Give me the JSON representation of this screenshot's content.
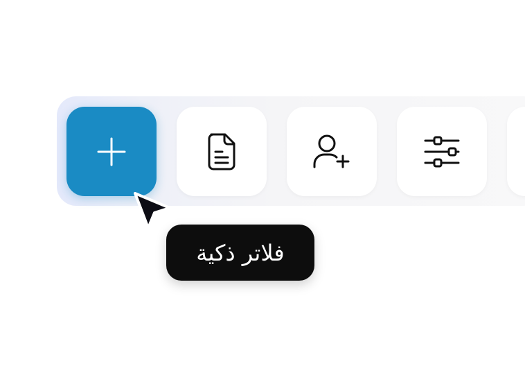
{
  "toolbar": {
    "buttons": [
      {
        "icon": "plus-icon",
        "accent": "#1a8bc4",
        "state": "active"
      },
      {
        "icon": "document-icon"
      },
      {
        "icon": "add-user-icon"
      },
      {
        "icon": "filter-sliders-icon"
      },
      {
        "icon": "partially-visible-button"
      }
    ]
  },
  "tooltip": {
    "text": "فلاتر ذكية"
  },
  "colors": {
    "accent": "#1a8bc4",
    "tooltip_bg": "#0d0d0d",
    "toolbar_bg": "#f3f4f8"
  }
}
